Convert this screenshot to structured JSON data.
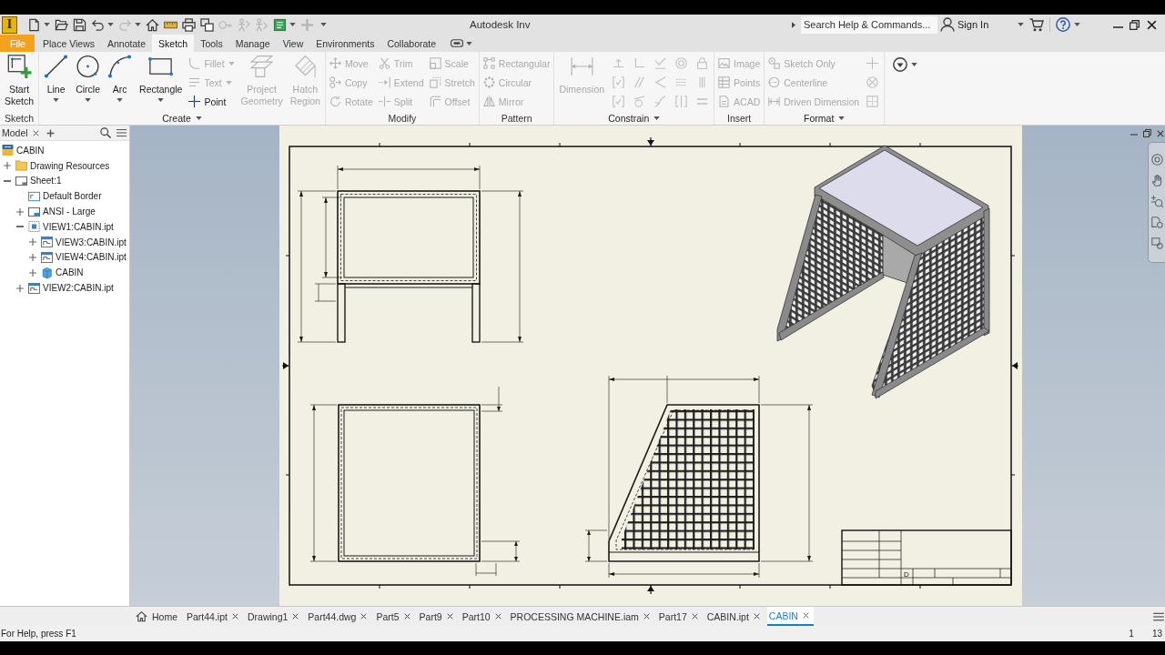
{
  "window": {
    "app_logo": "I",
    "quick_access": [
      {
        "disabled": false,
        "dropdown": true
      },
      {
        "disabled": false,
        "dropdown": false
      },
      {
        "disabled": false,
        "dropdown": false
      },
      {
        "disabled": false,
        "dropdown": true
      },
      {
        "disabled": true,
        "dropdown": true
      },
      {
        "disabled": false,
        "dropdown": false
      },
      {
        "disabled": false,
        "dropdown": false
      },
      {
        "disabled": false,
        "dropdown": false
      },
      {
        "disabled": false,
        "dropdown": false
      },
      {
        "disabled": true,
        "dropdown": false
      },
      {
        "disabled": true,
        "dropdown": false
      },
      {
        "disabled": true,
        "dropdown": false
      },
      {
        "disabled": false,
        "dropdown": true
      },
      {
        "disabled": true,
        "dropdown": false
      }
    ],
    "title": "Autodesk Inv",
    "search": {
      "placeholder": "Search Help & Commands..."
    },
    "sign_in": "Sign In"
  },
  "tabs": [
    {
      "label": "File",
      "kind": "file",
      "selected": false
    },
    {
      "label": "Place Views",
      "kind": "tab",
      "selected": false
    },
    {
      "label": "Annotate",
      "kind": "tab",
      "selected": false
    },
    {
      "label": "Sketch",
      "kind": "tab",
      "selected": true
    },
    {
      "label": "Tools",
      "kind": "tab",
      "selected": false
    },
    {
      "label": "Manage",
      "kind": "tab",
      "selected": false
    },
    {
      "label": "View",
      "kind": "tab",
      "selected": false
    },
    {
      "label": "Environments",
      "kind": "tab",
      "selected": false
    },
    {
      "label": "Collaborate",
      "kind": "tab",
      "selected": false
    }
  ],
  "ribbon": {
    "groups": [
      {
        "label": "Sketch",
        "menu": false,
        "items": [
          {
            "kind": "large",
            "label": "Start Sketch",
            "disabled": false,
            "dropdown": false
          }
        ]
      },
      {
        "label": "Create",
        "menu": true,
        "items": [
          {
            "kind": "large",
            "label": "Line",
            "disabled": false,
            "dropdown": true
          },
          {
            "kind": "large",
            "label": "Circle",
            "disabled": false,
            "dropdown": true
          },
          {
            "kind": "large",
            "label": "Arc",
            "disabled": false,
            "dropdown": true
          },
          {
            "kind": "large",
            "label": "Rectangle",
            "disabled": false,
            "dropdown": true
          },
          {
            "kind": "stack",
            "entries": [
              {
                "label": "Fillet",
                "disabled": true,
                "dropdown": true
              },
              {
                "label": "Text",
                "disabled": true,
                "dropdown": true
              },
              {
                "label": "Point",
                "disabled": false,
                "dropdown": false
              }
            ]
          },
          {
            "kind": "large",
            "label": "Project Geometry",
            "disabled": true,
            "dropdown": false
          },
          {
            "kind": "large",
            "label": "Hatch Region",
            "disabled": true,
            "dropdown": false
          }
        ]
      },
      {
        "label": "Modify",
        "menu": false,
        "items": [
          {
            "kind": "stack",
            "entries": [
              {
                "label": "Move",
                "disabled": true,
                "dropdown": false
              },
              {
                "label": "Copy",
                "disabled": true,
                "dropdown": false
              },
              {
                "label": "Rotate",
                "disabled": true,
                "dropdown": false
              }
            ]
          },
          {
            "kind": "stack",
            "entries": [
              {
                "label": "Trim",
                "disabled": true,
                "dropdown": false
              },
              {
                "label": "Extend",
                "disabled": true,
                "dropdown": false
              },
              {
                "label": "Split",
                "disabled": true,
                "dropdown": false
              }
            ]
          },
          {
            "kind": "stack",
            "entries": [
              {
                "label": "Scale",
                "disabled": true,
                "dropdown": false
              },
              {
                "label": "Stretch",
                "disabled": true,
                "dropdown": false
              },
              {
                "label": "Offset",
                "disabled": true,
                "dropdown": false
              }
            ]
          }
        ]
      },
      {
        "label": "Pattern",
        "menu": false,
        "items": [
          {
            "kind": "stack",
            "entries": [
              {
                "label": "Rectangular",
                "disabled": true,
                "dropdown": false
              },
              {
                "label": "Circular",
                "disabled": true,
                "dropdown": false
              },
              {
                "label": "Mirror",
                "disabled": true,
                "dropdown": false
              }
            ]
          }
        ]
      },
      {
        "label": "Constrain",
        "menu": true,
        "items": [
          {
            "kind": "large",
            "label": "Dimension",
            "disabled": true,
            "dropdown": false
          },
          {
            "kind": "icons",
            "entries": [
              {
                "disabled": true
              },
              {
                "disabled": true
              },
              {
                "disabled": true
              }
            ]
          },
          {
            "kind": "icons",
            "entries": [
              {
                "disabled": true
              },
              {
                "disabled": true
              },
              {
                "disabled": true
              }
            ]
          },
          {
            "kind": "icons",
            "entries": [
              {
                "disabled": true
              },
              {
                "disabled": true
              },
              {
                "disabled": true
              }
            ]
          },
          {
            "kind": "icons",
            "entries": [
              {
                "disabled": true
              },
              {
                "disabled": true
              },
              {
                "disabled": true
              }
            ]
          },
          {
            "kind": "icons",
            "entries": [
              {
                "disabled": true
              },
              {
                "disabled": true
              },
              {
                "disabled": true
              }
            ]
          }
        ]
      },
      {
        "label": "Insert",
        "menu": false,
        "items": [
          {
            "kind": "stack",
            "entries": [
              {
                "label": "Image",
                "disabled": true,
                "dropdown": false
              },
              {
                "label": "Points",
                "disabled": true,
                "dropdown": false
              },
              {
                "label": "ACAD",
                "disabled": true,
                "dropdown": false
              }
            ]
          }
        ]
      },
      {
        "label": "Format",
        "menu": true,
        "items": [
          {
            "kind": "stack",
            "entries": [
              {
                "label": "Sketch Only",
                "disabled": true,
                "dropdown": false
              },
              {
                "label": "Centerline",
                "disabled": true,
                "dropdown": false
              },
              {
                "label": "Driven Dimension",
                "disabled": true,
                "dropdown": false
              }
            ]
          },
          {
            "kind": "icons",
            "entries": [
              {
                "disabled": true
              },
              {
                "disabled": true
              },
              {
                "disabled": true
              }
            ]
          }
        ]
      },
      {
        "items": [
          {
            "kind": "icon",
            "disabled": false,
            "dropdown": true
          }
        ]
      }
    ]
  },
  "browser": {
    "title": "Model",
    "tree": {
      "label": "CABIN",
      "kind": "drawing",
      "children": [
        {
          "label": "Drawing Resources",
          "kind": "folder",
          "expanded": false
        },
        {
          "label": "Sheet:1",
          "kind": "sheet",
          "expanded": true,
          "children": [
            {
              "label": "Default Border",
              "kind": "border"
            },
            {
              "label": "ANSI - Large",
              "kind": "title_block",
              "expanded": false
            },
            {
              "label": "VIEW1:CABIN.ipt",
              "kind": "base_view",
              "expanded": true,
              "children": [
                {
                  "label": "VIEW3:CABIN.ipt",
                  "kind": "view",
                  "expanded": false
                },
                {
                  "label": "VIEW4:CABIN.ipt",
                  "kind": "view",
                  "expanded": false
                },
                {
                  "label": "CABIN",
                  "kind": "part",
                  "expanded": false
                }
              ]
            },
            {
              "label": "VIEW2:CABIN.ipt",
              "kind": "view",
              "expanded": false
            }
          ]
        }
      ]
    }
  },
  "sheet": {
    "size": "D"
  },
  "document_tabs": [
    {
      "label": "Home",
      "kind": "home",
      "selected": false
    },
    {
      "label": "Part44.ipt",
      "kind": "document",
      "selected": false
    },
    {
      "label": "Drawing1",
      "kind": "document",
      "selected": false
    },
    {
      "label": "Part44.dwg",
      "kind": "document",
      "selected": false
    },
    {
      "label": "Part5",
      "kind": "document",
      "selected": false
    },
    {
      "label": "Part9",
      "kind": "document",
      "selected": false
    },
    {
      "label": "Part10",
      "kind": "document",
      "selected": false
    },
    {
      "label": "PROCESSING MACHINE.iam",
      "kind": "document",
      "selected": false
    },
    {
      "label": "Part17",
      "kind": "document",
      "selected": false
    },
    {
      "label": "CABIN.ipt",
      "kind": "document",
      "selected": false
    },
    {
      "label": "CABIN",
      "kind": "document",
      "selected": true
    }
  ],
  "status_bar": {
    "help": "For Help, press F1",
    "field_1": "1",
    "field_2": "13"
  }
}
